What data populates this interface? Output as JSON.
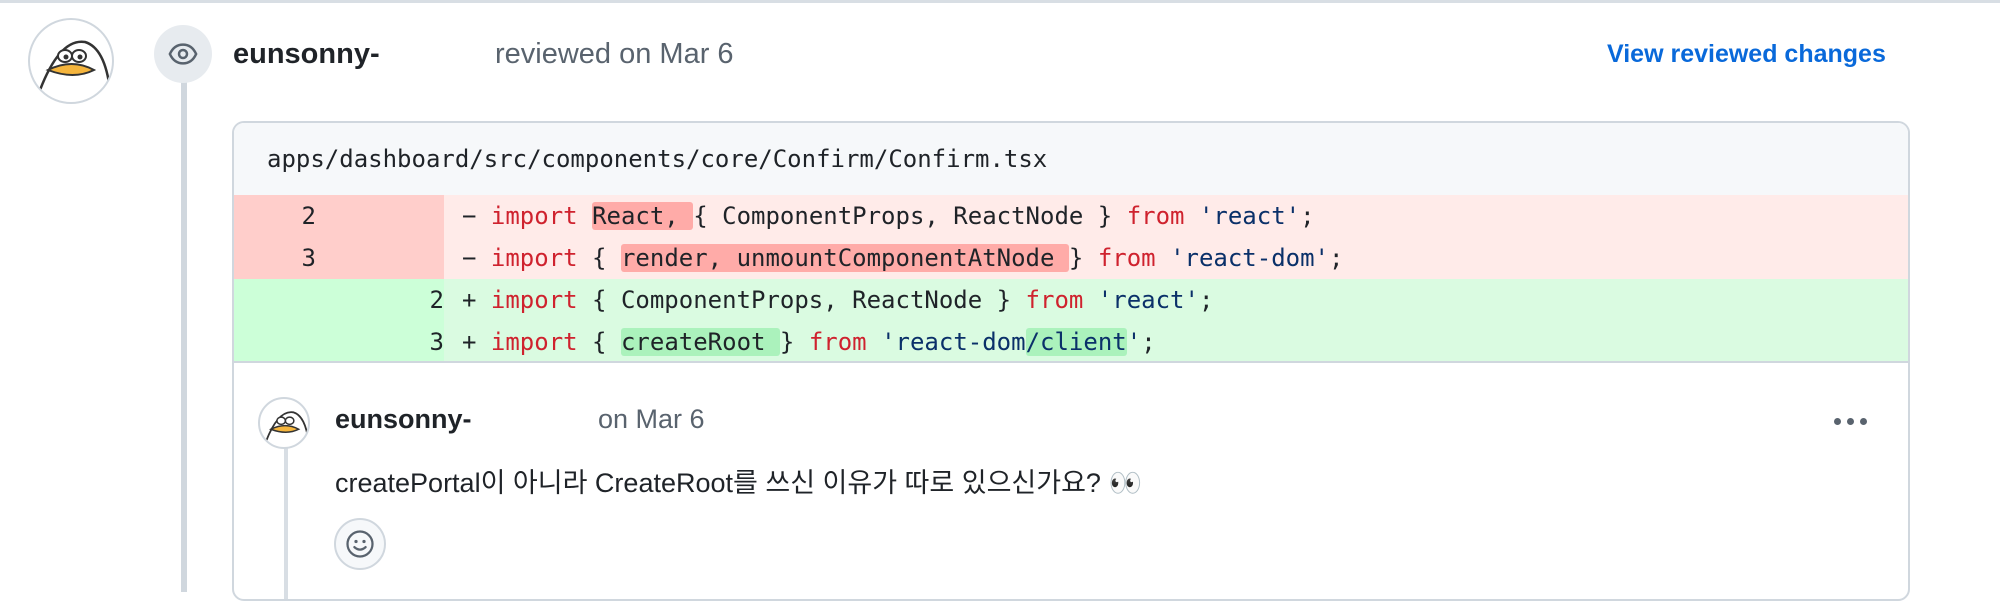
{
  "review": {
    "author": "eunsonny-",
    "meta": "reviewed on Mar 6",
    "view_changes": "View reviewed changes",
    "icon": "eye-icon"
  },
  "file": {
    "path": "apps/dashboard/src/components/core/Confirm/Confirm.tsx"
  },
  "diff": [
    {
      "type": "del",
      "old": "2",
      "new": "",
      "sign": "−",
      "tokens": [
        [
          "kw",
          "import"
        ],
        [
          "t",
          " "
        ],
        [
          "hl-del",
          "React, "
        ],
        [
          "t",
          "{ ComponentProps, ReactNode } "
        ],
        [
          "kw",
          "from"
        ],
        [
          "t",
          " "
        ],
        [
          "str",
          "'react'"
        ],
        [
          "t",
          ";"
        ]
      ]
    },
    {
      "type": "del",
      "old": "3",
      "new": "",
      "sign": "−",
      "tokens": [
        [
          "kw",
          "import"
        ],
        [
          "t",
          " { "
        ],
        [
          "hl-del",
          "render, unmountComponentAtNode "
        ],
        [
          "t",
          "} "
        ],
        [
          "kw",
          "from"
        ],
        [
          "t",
          " "
        ],
        [
          "str",
          "'react-dom'"
        ],
        [
          "t",
          ";"
        ]
      ]
    },
    {
      "type": "add",
      "old": "",
      "new": "2",
      "sign": "+",
      "tokens": [
        [
          "kw",
          "import"
        ],
        [
          "t",
          " { ComponentProps, ReactNode } "
        ],
        [
          "kw",
          "from"
        ],
        [
          "t",
          " "
        ],
        [
          "str",
          "'react'"
        ],
        [
          "t",
          ";"
        ]
      ]
    },
    {
      "type": "add",
      "old": "",
      "new": "3",
      "sign": "+",
      "tokens": [
        [
          "kw",
          "import"
        ],
        [
          "t",
          " { "
        ],
        [
          "hl-add",
          "createRoot "
        ],
        [
          "t",
          "} "
        ],
        [
          "kw",
          "from"
        ],
        [
          "t",
          " "
        ],
        [
          "str",
          "'react-dom"
        ],
        [
          "hl-add-str",
          "/client"
        ],
        [
          "str",
          "'"
        ],
        [
          "t",
          ";"
        ]
      ]
    }
  ],
  "comment": {
    "author": "eunsonny-",
    "date": "on Mar 6",
    "body": "createPortal이 아니라 CreateRoot를 쓰신 이유가 따로 있으신가요? 👀",
    "more_icon": "kebab-horizontal-icon",
    "reaction_icon": "smiley-icon"
  },
  "colors": {
    "link": "#0969da",
    "del_bg": "#ffebe9",
    "add_bg": "#dafbe1",
    "keyword": "#cf222e",
    "string": "#0a3069"
  }
}
